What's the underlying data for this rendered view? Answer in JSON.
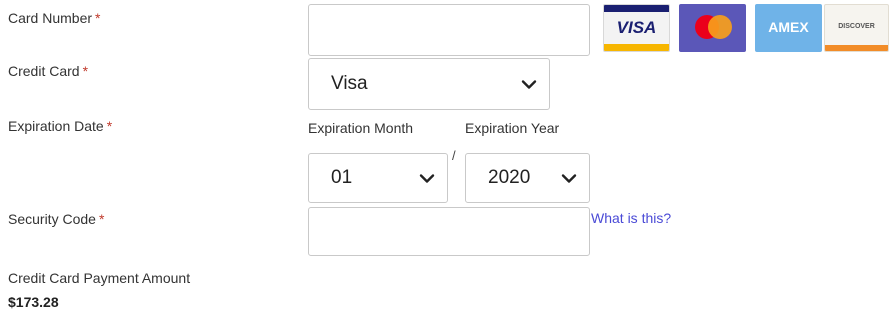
{
  "form": {
    "card_number": {
      "label": "Card Number",
      "required_mark": "*",
      "value": ""
    },
    "credit_card": {
      "label": "Credit Card",
      "required_mark": "*",
      "selected": "Visa"
    },
    "expiration": {
      "label": "Expiration Date",
      "required_mark": "*",
      "month_label": "Expiration Month",
      "year_label": "Expiration Year",
      "month": "01",
      "separator": "/",
      "year": "2020"
    },
    "security_code": {
      "label": "Security Code",
      "required_mark": "*",
      "value": "",
      "help_link": "What is this?"
    },
    "payment": {
      "label": "Credit Card Payment Amount",
      "amount": "$173.28"
    }
  },
  "card_logos": [
    {
      "name": "visa",
      "text": "VISA"
    },
    {
      "name": "mastercard",
      "text": ""
    },
    {
      "name": "amex",
      "text": "AMEX"
    },
    {
      "name": "discover",
      "text": "DISCOVER"
    }
  ],
  "colors": {
    "required": "#c0392b",
    "link": "#4a4ad6",
    "visa_blue": "#1a1f71",
    "visa_gold": "#f7b600",
    "mastercard_bg": "#5b57b8",
    "mastercard_red": "#eb001b",
    "mastercard_yellow": "#f79e1b",
    "amex_blue": "#6fb3e8"
  }
}
